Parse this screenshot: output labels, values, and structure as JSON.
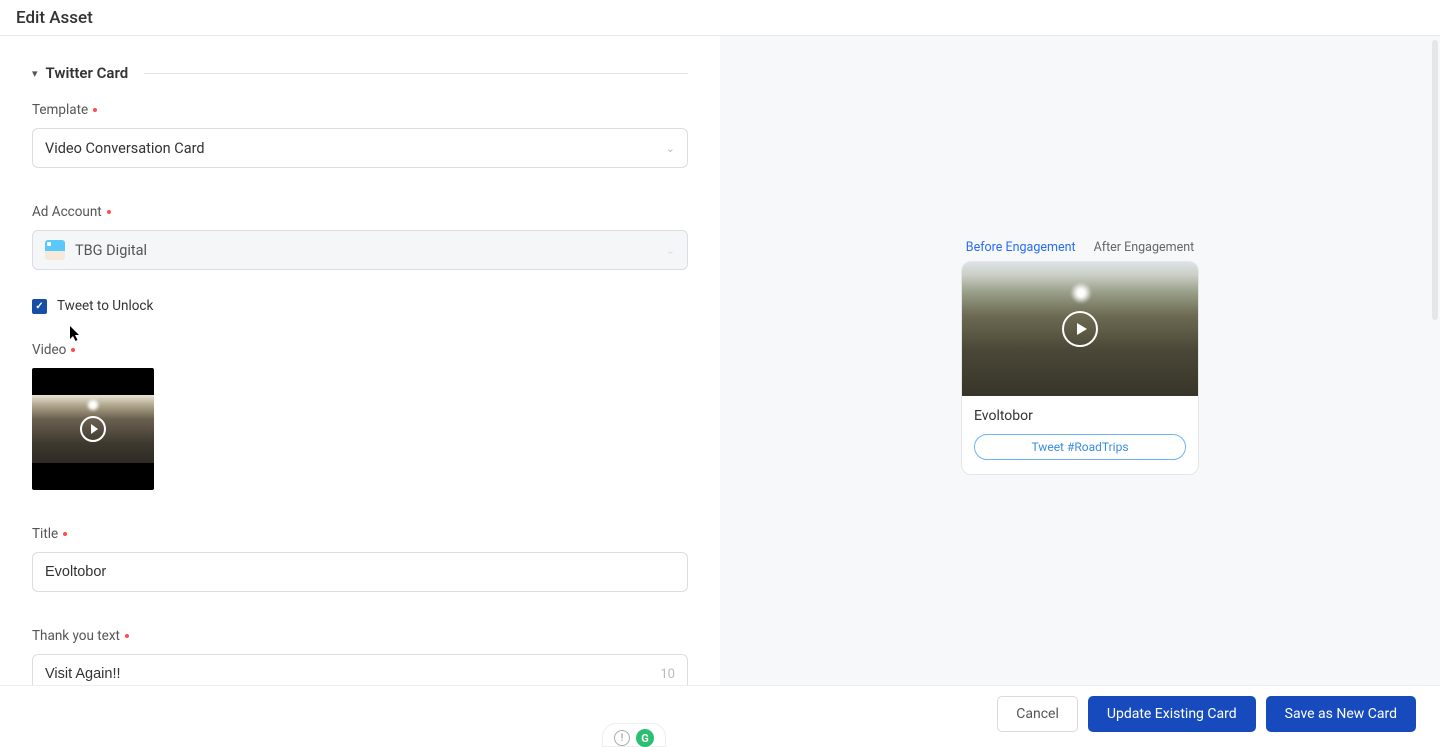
{
  "header": {
    "title": "Edit Asset"
  },
  "section": {
    "title": "Twitter Card"
  },
  "fields": {
    "template": {
      "label": "Template",
      "value": "Video Conversation Card"
    },
    "adAccount": {
      "label": "Ad Account",
      "value": "TBG Digital"
    },
    "tweetToUnlock": {
      "label": "Tweet to Unlock",
      "checked": true
    },
    "video": {
      "label": "Video"
    },
    "title": {
      "label": "Title",
      "value": "Evoltobor"
    },
    "thankYou": {
      "label": "Thank you text",
      "value": "Visit Again!!",
      "counter": "10"
    }
  },
  "preview": {
    "tabs": {
      "before": "Before Engagement",
      "after": "After Engagement"
    },
    "title": "Evoltobor",
    "button": "Tweet #RoadTrips"
  },
  "footer": {
    "cancel": "Cancel",
    "update": "Update Existing Card",
    "save": "Save as New Card"
  }
}
